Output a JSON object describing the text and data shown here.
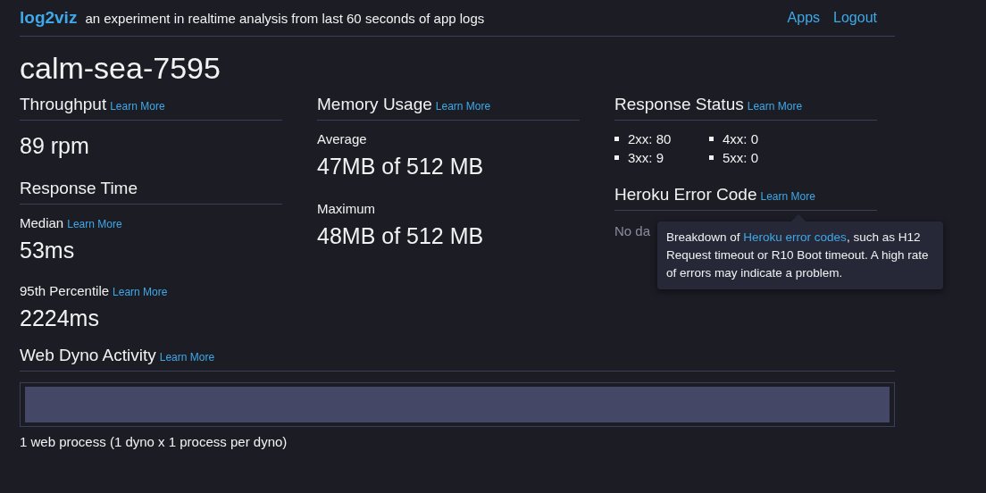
{
  "header": {
    "brand": "log2viz",
    "tagline": "an experiment in realtime analysis from last 60 seconds of app logs",
    "links": [
      "Apps",
      "Logout"
    ]
  },
  "app_name": "calm-sea-7595",
  "throughput": {
    "title": "Throughput",
    "link": "Learn More",
    "value": "89 rpm"
  },
  "response_time": {
    "title": "Response Time",
    "metrics": [
      {
        "label": "Median",
        "link": "Learn More",
        "value": "53ms"
      },
      {
        "label": "95th Percentile",
        "link": "Learn More",
        "value": "2224ms"
      }
    ]
  },
  "memory": {
    "title": "Memory Usage",
    "link": "Learn More",
    "metrics": [
      {
        "label": "Average",
        "value": "47MB of 512 MB"
      },
      {
        "label": "Maximum",
        "value": "48MB of 512 MB"
      }
    ]
  },
  "response_status": {
    "title": "Response Status",
    "link": "Learn More",
    "items": [
      "2xx: 80",
      "4xx: 0",
      "3xx: 9",
      "5xx: 0"
    ]
  },
  "error_code": {
    "title": "Heroku Error Code",
    "link": "Learn More",
    "empty_text": "No da",
    "tooltip": {
      "before": "Breakdown of ",
      "link": "Heroku error codes",
      "after": ", such as H12 Request timeout or R10 Boot timeout. A high rate of errors may indicate a problem."
    }
  },
  "dyno": {
    "title": "Web Dyno Activity",
    "link": "Learn More",
    "level": 1,
    "caption": "1 web process (1 dyno x 1 process per dyno)"
  }
}
